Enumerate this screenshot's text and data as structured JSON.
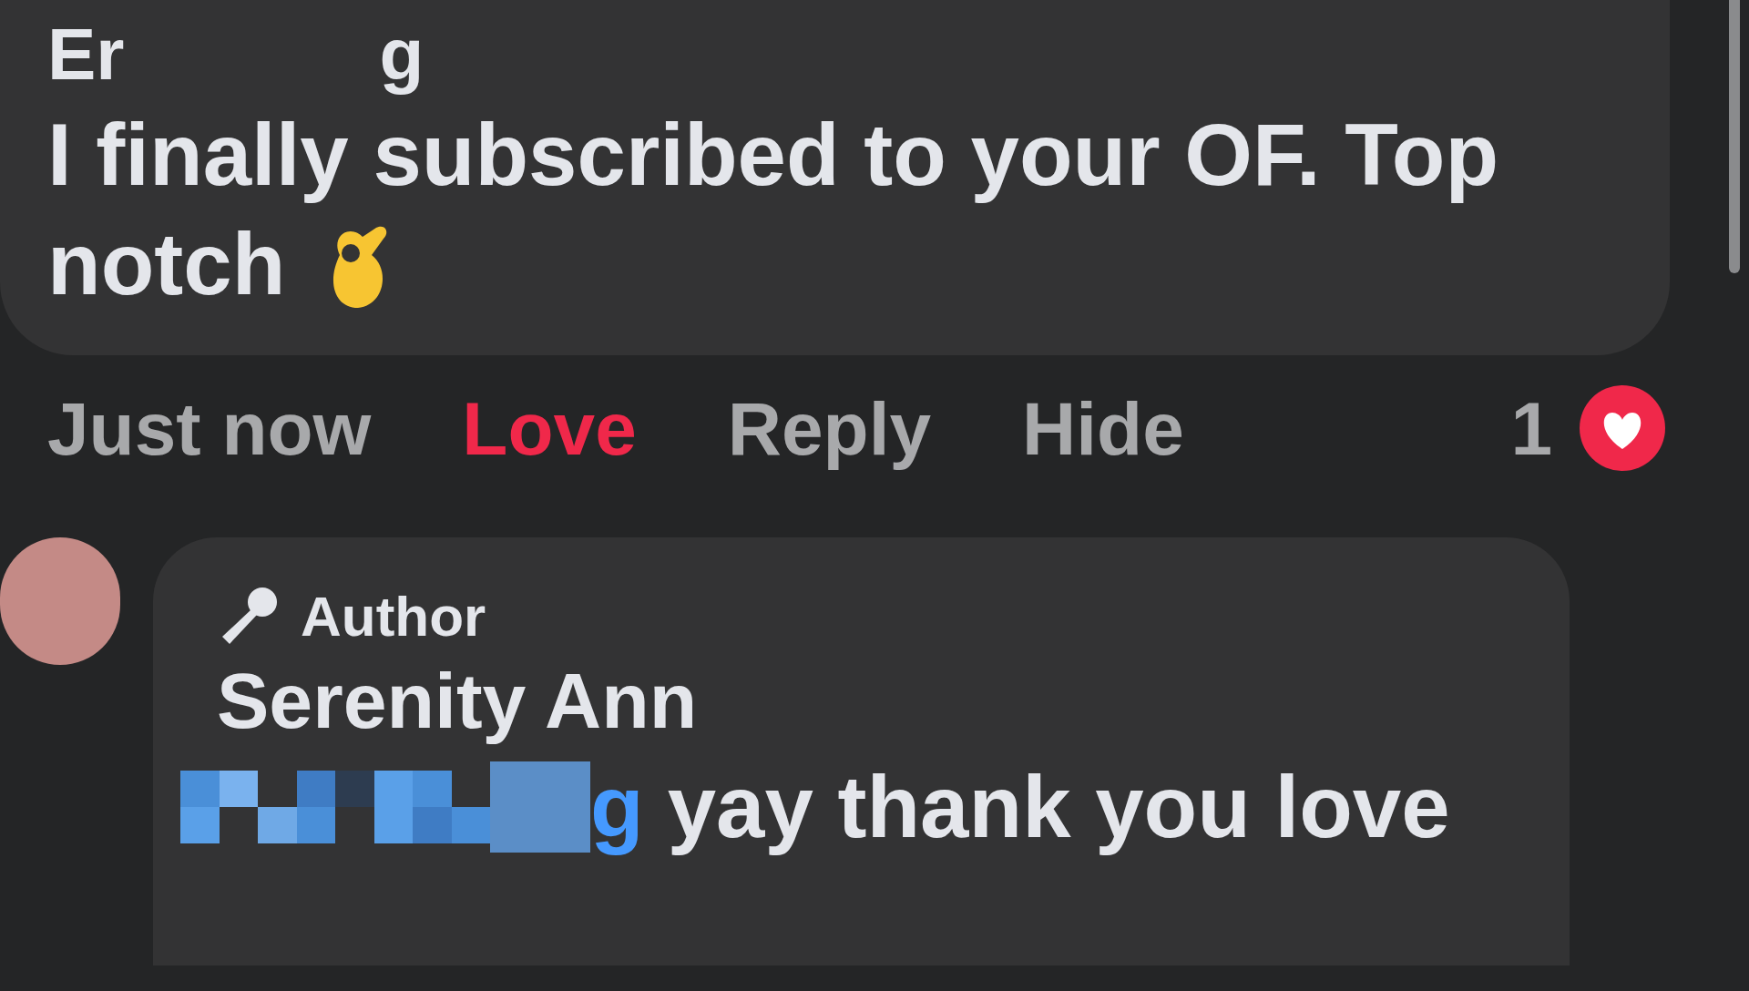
{
  "comment": {
    "name_parts": [
      "Er",
      "g"
    ],
    "lines": [
      "I finally subscribed to your OF. Top",
      "notch"
    ]
  },
  "actions": {
    "time": "Just now",
    "love": {
      "label": "Love",
      "selected": true
    },
    "reply": "Reply",
    "hide": "Hide",
    "reaction_count": "1"
  },
  "reply": {
    "badge": "Author",
    "name": "Serenity Ann",
    "mention_visible": "g",
    "text": "yay thank you love"
  }
}
